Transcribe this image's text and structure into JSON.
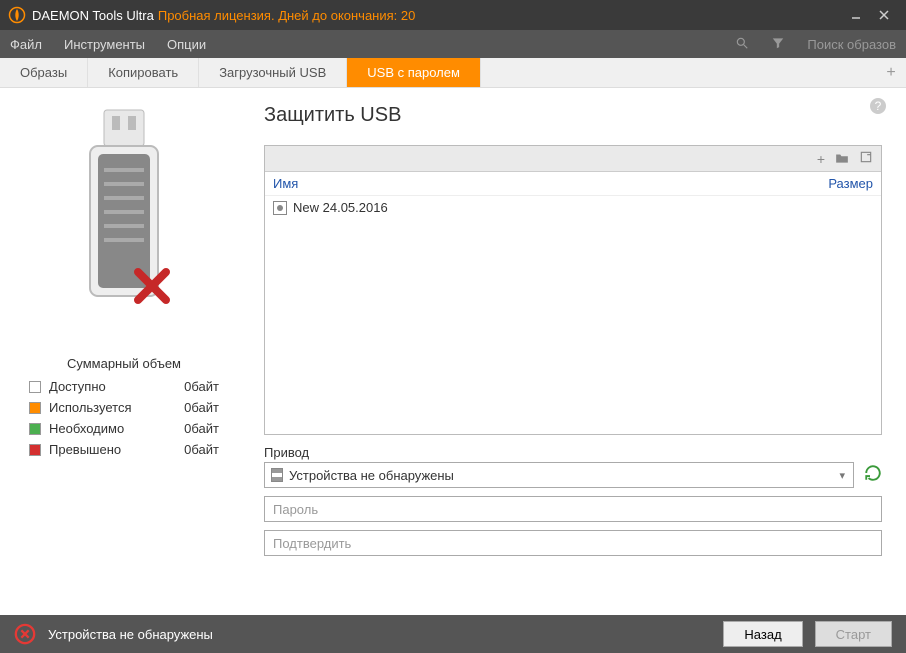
{
  "titlebar": {
    "app_name": "DAEMON Tools Ultra",
    "trial_text": "Пробная лицензия. Дней до окончания: 20"
  },
  "menubar": {
    "file": "Файл",
    "tools": "Инструменты",
    "options": "Опции",
    "search_placeholder": "Поиск образов"
  },
  "tabs": {
    "items": [
      "Образы",
      "Копировать",
      "Загрузочный USB",
      "USB с паролем"
    ],
    "active_index": 3
  },
  "main": {
    "heading": "Защитить USB",
    "file_list": {
      "col_name": "Имя",
      "col_size": "Размер",
      "items": [
        {
          "name": "New 24.05.2016"
        }
      ]
    },
    "drive": {
      "label": "Привод",
      "selected": "Устройства не обнаружены"
    },
    "password_placeholder": "Пароль",
    "confirm_placeholder": "Подтвердить"
  },
  "legend": {
    "title": "Суммарный объем",
    "rows": [
      {
        "color": "#ffffff",
        "label": "Доступно",
        "value": "0байт"
      },
      {
        "color": "#ff8c00",
        "label": "Используется",
        "value": "0байт"
      },
      {
        "color": "#4caf50",
        "label": "Необходимо",
        "value": "0байт"
      },
      {
        "color": "#d32f2f",
        "label": "Превышено",
        "value": "0байт"
      }
    ]
  },
  "footer": {
    "error_text": "Устройства не обнаружены",
    "back": "Назад",
    "start": "Старт"
  }
}
